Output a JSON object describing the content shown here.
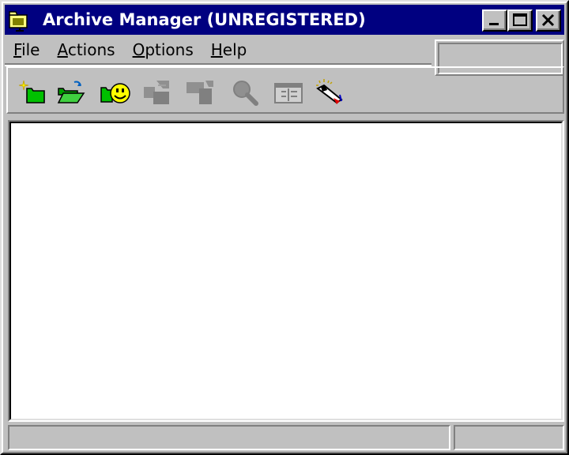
{
  "window": {
    "title": "Archive Manager (UNREGISTERED)",
    "icons": {
      "app": "folder-app-icon",
      "minimize": "minimize-icon",
      "maximize": "maximize-icon",
      "close": "close-icon"
    }
  },
  "menu": {
    "items": [
      {
        "label": "File",
        "mnemonic": "F",
        "rest": "ile"
      },
      {
        "label": "Actions",
        "mnemonic": "A",
        "rest": "ctions"
      },
      {
        "label": "Options",
        "mnemonic": "O",
        "rest": "ptions"
      },
      {
        "label": "Help",
        "mnemonic": "H",
        "rest": "elp"
      }
    ]
  },
  "toolbar": {
    "buttons": [
      {
        "icon": "new-archive-icon",
        "enabled": true
      },
      {
        "icon": "open-archive-icon",
        "enabled": true
      },
      {
        "icon": "favorites-icon",
        "enabled": true
      },
      {
        "icon": "add-files-icon",
        "enabled": false
      },
      {
        "icon": "extract-icon",
        "enabled": false
      },
      {
        "icon": "view-icon",
        "enabled": false
      },
      {
        "icon": "properties-icon",
        "enabled": false
      },
      {
        "icon": "wizard-icon",
        "enabled": true
      }
    ]
  },
  "statusbar": {
    "left": "",
    "right": ""
  },
  "colors": {
    "titlebar": "#000080",
    "face": "#c0c0c0",
    "content": "#ffffff"
  }
}
